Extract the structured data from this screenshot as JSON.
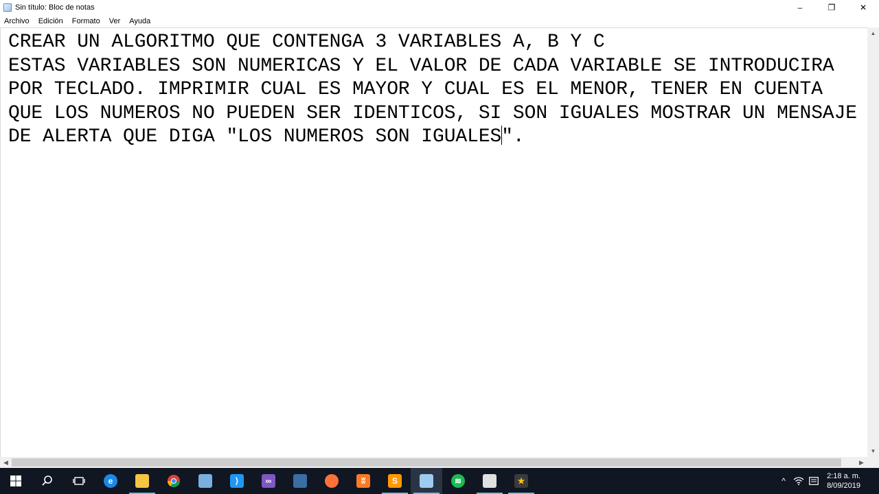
{
  "window": {
    "title": "Sin título: Bloc de notas",
    "controls": {
      "minimize": "–",
      "restore": "❐",
      "close": "✕"
    }
  },
  "menu": [
    "Archivo",
    "Edición",
    "Formato",
    "Ver",
    "Ayuda"
  ],
  "document": {
    "lines": [
      "CREAR UN ALGORITMO QUE CONTENGA 3 VARIABLES A, B Y C",
      "ESTAS VARIABLES SON NUMERICAS Y EL VALOR DE CADA VARIABLE SE INTRODUCIRA",
      "POR TECLADO. IMPRIMIR CUAL ES MAYOR Y CUAL ES EL MENOR, TENER EN CUENTA",
      "QUE LOS NUMEROS NO PUEDEN SER IDENTICOS, SI SON IGUALES MOSTRAR UN MENSAJE",
      "DE ALERTA QUE DIGA \"LOS NUMEROS SON IGUALES"
    ],
    "last_line_after_caret": "\"."
  },
  "taskbar": {
    "apps": [
      {
        "name": "start",
        "icon": "windows-start-icon",
        "color": "#ffffff"
      },
      {
        "name": "search",
        "icon": "search-icon",
        "color": "#ffffff"
      },
      {
        "name": "task-view",
        "icon": "task-view-icon",
        "color": "#ffffff"
      },
      {
        "name": "edge",
        "icon": "edge-icon",
        "color": "#1e88e5"
      },
      {
        "name": "file-explorer",
        "icon": "folder-icon",
        "color": "#f4c542"
      },
      {
        "name": "chrome",
        "icon": "chrome-icon",
        "color": "#4caf50"
      },
      {
        "name": "virtualbox",
        "icon": "cube-icon",
        "color": "#7ab0e0"
      },
      {
        "name": "vscode",
        "icon": "vscode-icon",
        "color": "#2196f3"
      },
      {
        "name": "visual-studio",
        "icon": "visual-studio-icon",
        "color": "#7e57c2"
      },
      {
        "name": "mysql-workbench",
        "icon": "database-icon",
        "color": "#3a6ea5"
      },
      {
        "name": "firefox",
        "icon": "firefox-icon",
        "color": "#ff7139"
      },
      {
        "name": "xampp",
        "icon": "xampp-icon",
        "color": "#fb7a24"
      },
      {
        "name": "sublime",
        "icon": "sublime-icon",
        "color": "#ff9800"
      },
      {
        "name": "notepad",
        "icon": "notepad-icon",
        "color": "#9ecbf0"
      },
      {
        "name": "spotify",
        "icon": "spotify-icon",
        "color": "#1db954"
      },
      {
        "name": "installer",
        "icon": "installer-icon",
        "color": "#e0e0e0"
      },
      {
        "name": "video-editor",
        "icon": "star-icon",
        "color": "#f5c518"
      }
    ],
    "clock": {
      "time": "2:18 a. m.",
      "date": "8/09/2019"
    }
  }
}
